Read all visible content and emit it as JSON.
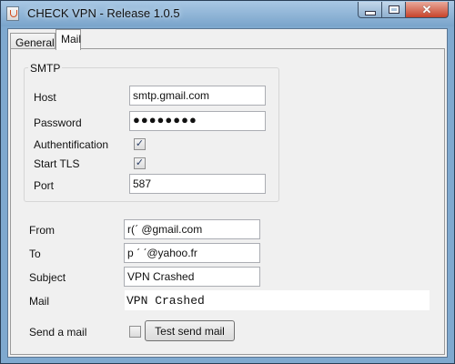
{
  "window": {
    "title": "CHECK VPN - Release 1.0.5"
  },
  "tabs": [
    {
      "label": "General",
      "active": false
    },
    {
      "label": "Mail",
      "active": true
    }
  ],
  "smtp": {
    "legend": "SMTP",
    "host_label": "Host",
    "host_value": "smtp.gmail.com",
    "password_label": "Password",
    "password_value": "●●●●●●●●",
    "auth_label": "Authentification",
    "auth_checked": true,
    "tls_label": "Start TLS",
    "tls_checked": true,
    "port_label": "Port",
    "port_value": "587"
  },
  "mail": {
    "from_label": "From",
    "from_value": "r(ˊ               @gmail.com",
    "to_label": "To",
    "to_value": "p          ˊ    ˊ@yahoo.fr",
    "subject_label": "Subject",
    "subject_value": "VPN Crashed",
    "mail_label": "Mail",
    "mail_value": "VPN Crashed",
    "send_label": "Send a mail",
    "send_checked": false,
    "test_button": "Test send mail"
  },
  "icons": {
    "app": "java-app-icon",
    "minimize": "minimize-icon",
    "maximize": "maximize-icon",
    "close": "close-icon",
    "check": "checkmark-icon"
  },
  "colors": {
    "titlebar": "#7aa4cb",
    "close_button": "#c7432a",
    "panel_bg": "#f0f0f0"
  }
}
